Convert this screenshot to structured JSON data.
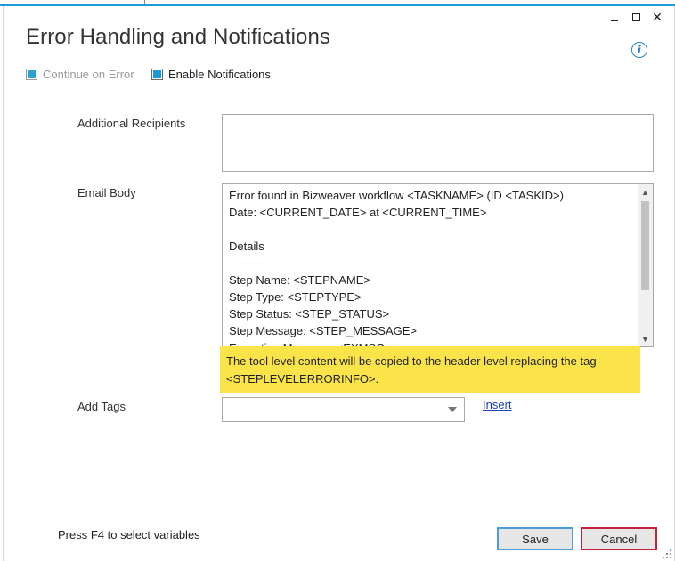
{
  "window": {
    "title": "Error Handling and Notifications",
    "controls": {
      "minimize": "_",
      "maximize": "□",
      "close": "✕"
    }
  },
  "options": {
    "continue_on_error": {
      "label": "Continue on Error",
      "checked": true,
      "disabled": true
    },
    "enable_notifications": {
      "label": "Enable Notifications",
      "checked": true,
      "disabled": false
    }
  },
  "form": {
    "additional_recipients": {
      "label": "Additional Recipients",
      "value": ""
    },
    "email_body": {
      "label": "Email Body",
      "value": "Error found in Bizweaver workflow <TASKNAME> (ID <TASKID>)\nDate: <CURRENT_DATE> at <CURRENT_TIME>\n\nDetails\n-----------\nStep Name: <STEPNAME>\nStep Type: <STEPTYPE>\nStep Status: <STEP_STATUS>\nStep Message: <STEP_MESSAGE>\nException Message: <EXMSG>"
    },
    "note": "The tool level content will be copied to the header level replacing the tag <STEPLEVELERRORINFO>.",
    "add_tags": {
      "label": "Add Tags",
      "value": ""
    },
    "insert_link": "Insert"
  },
  "footer": {
    "hint": "Press F4 to select variables",
    "save_label": "Save",
    "cancel_label": "Cancel"
  },
  "colors": {
    "accent": "#1e9bd6",
    "note_background": "#fbe34a",
    "save_border": "#4a9fd8",
    "cancel_border": "#c2223a",
    "link": "#1a3fbd"
  }
}
